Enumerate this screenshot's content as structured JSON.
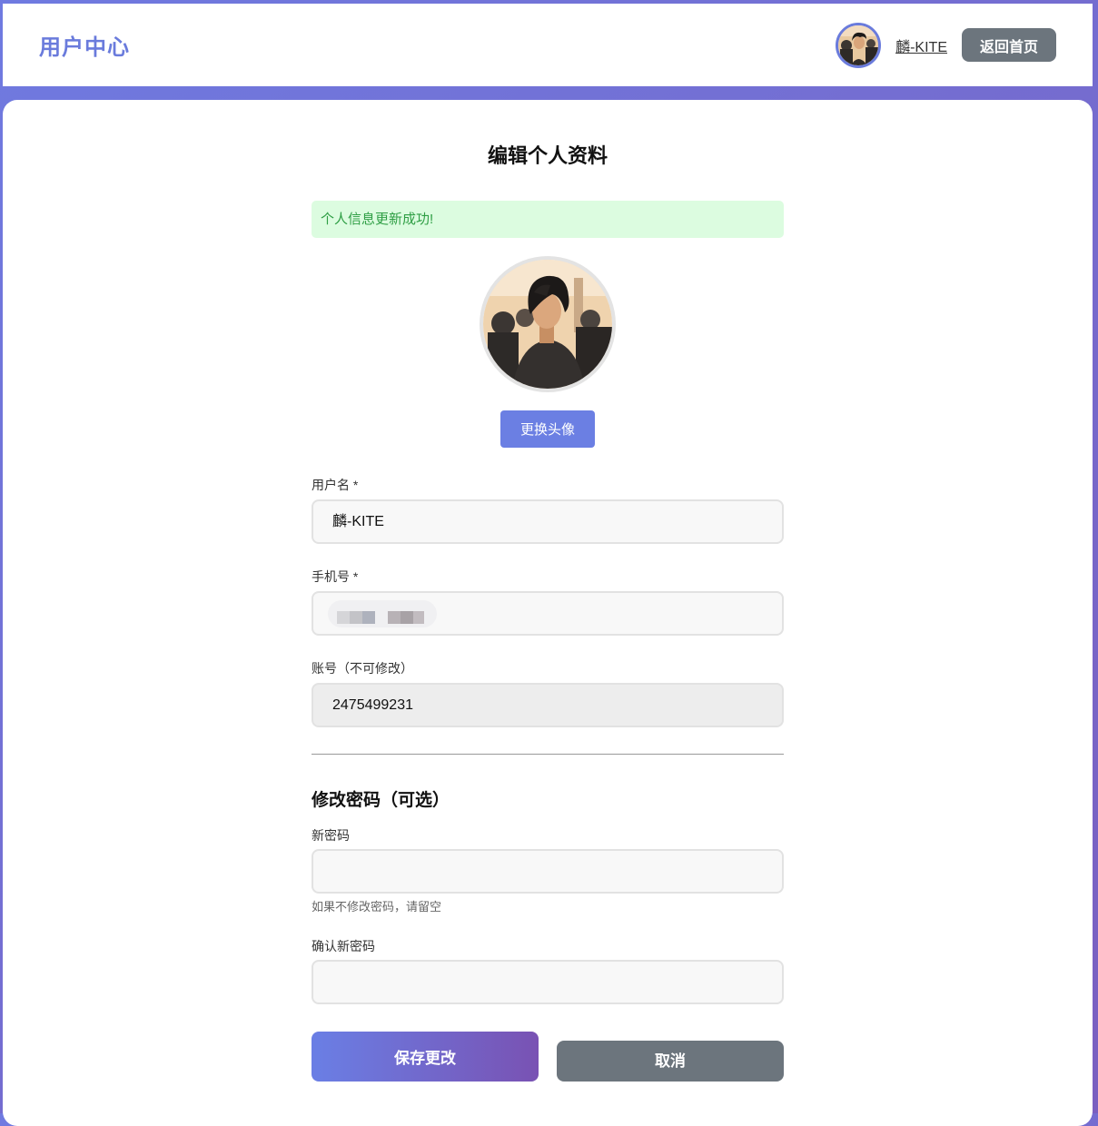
{
  "header": {
    "brand": "用户中心",
    "username": "麟-KITE",
    "home_label": "返回首页"
  },
  "form": {
    "title": "编辑个人资料",
    "alert": "个人信息更新成功!",
    "change_avatar_label": "更换头像",
    "username_label": "用户名 *",
    "username_value": "麟-KITE",
    "phone_label": "手机号 *",
    "account_label": "账号（不可修改）",
    "account_value": "2475499231",
    "password_section": "修改密码（可选）",
    "new_password_label": "新密码",
    "new_password_hint": "如果不修改密码，请留空",
    "confirm_password_label": "确认新密码",
    "save_label": "保存更改",
    "cancel_label": "取消"
  },
  "colors": {
    "accent": "#6a7bdc",
    "success_bg": "#dcfce0",
    "success_text": "#2e9e44",
    "gray_button": "#6c757d"
  }
}
